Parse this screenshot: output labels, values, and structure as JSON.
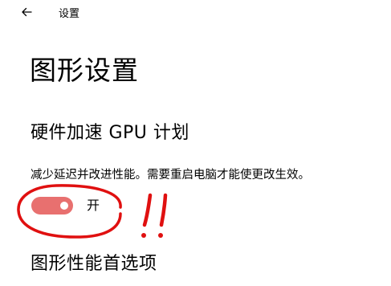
{
  "header": {
    "back_icon": "back-arrow-icon",
    "title": "设置"
  },
  "page": {
    "title": "图形设置"
  },
  "gpu_scheduling": {
    "heading": "硬件加速 GPU 计划",
    "description": "减少延迟并改进性能。需要重启电脑才能使更改生效。",
    "toggle": {
      "state": "on",
      "label": "开",
      "accent_color": "#e8706f"
    }
  },
  "graphics_performance": {
    "heading": "图形性能首选项"
  },
  "annotation": {
    "marker_color": "#e01010",
    "marks": "!!"
  }
}
